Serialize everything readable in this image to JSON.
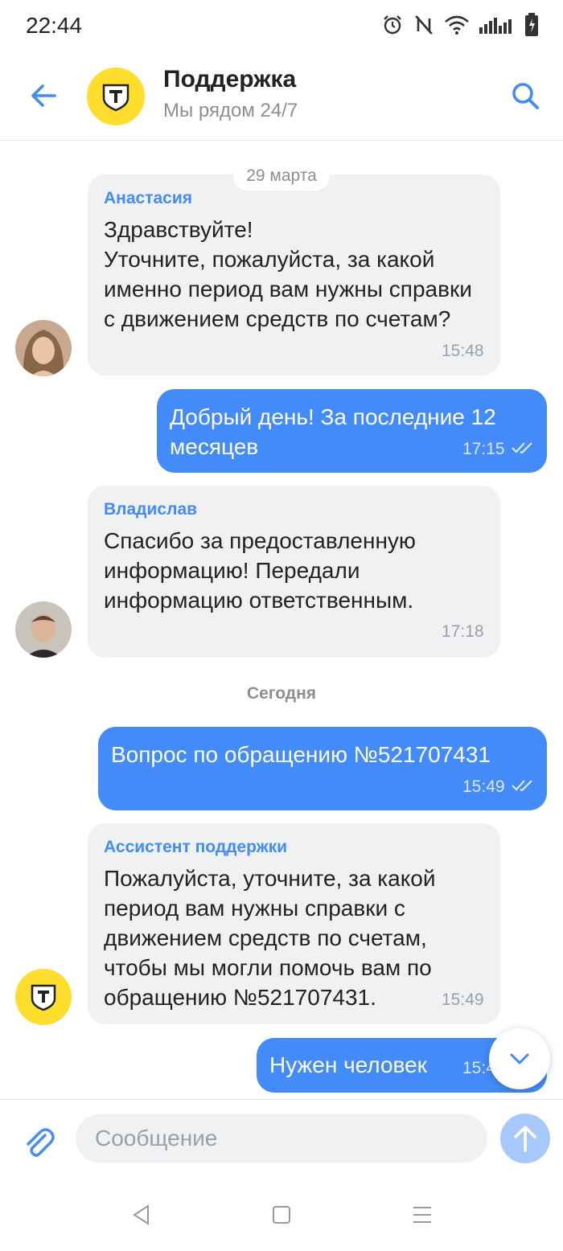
{
  "status_bar": {
    "time": "22:44"
  },
  "header": {
    "title": "Поддержка",
    "subtitle": "Мы рядом 24/7",
    "logo_letter": "T"
  },
  "chat": {
    "date_1": "29 марта",
    "date_2": "Сегодня",
    "messages": [
      {
        "sender": "Анастасия",
        "text": "Здравствуйте!\nУточните, пожалуйста, за какой именно период вам нужны справки с движением средств по счетам?",
        "time": "15:48"
      },
      {
        "text": "Добрый день! За последние 12 месяцев",
        "time": "17:15"
      },
      {
        "sender": "Владислав",
        "text": "Спасибо за предоставленную информацию! Передали информацию ответственным.",
        "time": "17:18"
      },
      {
        "text": "Вопрос по обращению №521707431",
        "time": "15:49"
      },
      {
        "sender": "Ассистент поддержки",
        "text": "Пожалуйста, уточните, за какой период вам нужны справки с движением средств по счетам, чтобы мы могли помочь вам по обращению №521707431.",
        "time": "15:49"
      },
      {
        "text": "Нужен человек",
        "time": "15:4"
      }
    ]
  },
  "input": {
    "placeholder": "Сообщение"
  },
  "colors": {
    "accent": "#428bf9",
    "brand_yellow": "#ffdd2d",
    "incoming_bubble": "#f0f1f3"
  }
}
